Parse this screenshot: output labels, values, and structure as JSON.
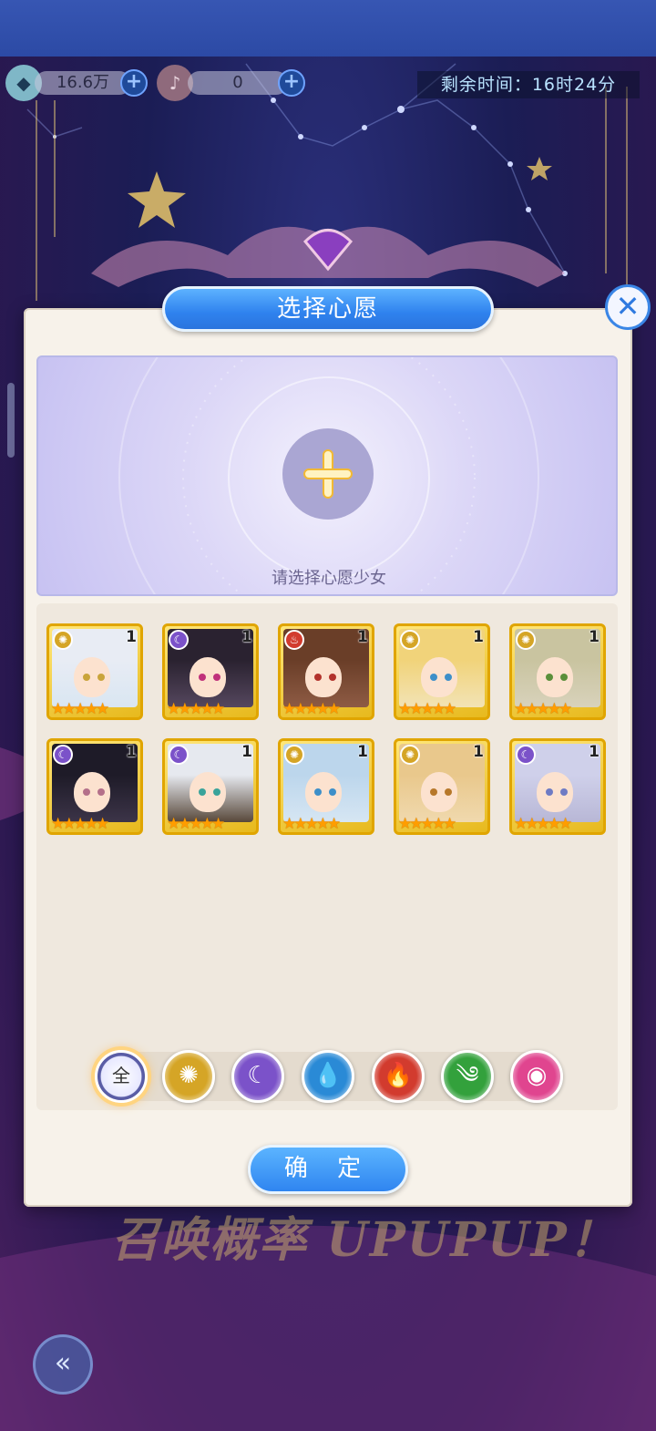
{
  "resources": {
    "gem_amount": "16.6万",
    "ticket_amount": "0"
  },
  "timer": {
    "text": "剩余时间：16时24分"
  },
  "dialog": {
    "title": "选择心愿",
    "close_glyph": "✕",
    "wish_hint": "请选择心愿少女",
    "confirm_label": "确 定"
  },
  "cards": [
    {
      "element": "light",
      "level": "1",
      "hair": "#e8ecf4",
      "eyes": "#c9a43a",
      "bg": "#d9e6f2"
    },
    {
      "element": "dark",
      "level": "1",
      "hair": "#2a2230",
      "eyes": "#c0307a",
      "bg": "#55475e"
    },
    {
      "element": "fire",
      "level": "1",
      "hair": "#6a3e28",
      "eyes": "#b3322b",
      "bg": "#8e5b44"
    },
    {
      "element": "light",
      "level": "1",
      "hair": "#f1d37a",
      "eyes": "#3d8fc9",
      "bg": "#f2e3b5"
    },
    {
      "element": "light",
      "level": "1",
      "hair": "#c9c4a0",
      "eyes": "#5a8f3a",
      "bg": "#d8d2bb"
    },
    {
      "element": "dark",
      "level": "1",
      "hair": "#1e1b28",
      "eyes": "#b4708a",
      "bg": "#3c3448"
    },
    {
      "element": "dark",
      "level": "1",
      "hair": "#e6e9ef",
      "eyes": "#3aa39a",
      "bg": "#58483a"
    },
    {
      "element": "light",
      "level": "1",
      "hair": "#bcd6ec",
      "eyes": "#3d8fc9",
      "bg": "#d6e6f3"
    },
    {
      "element": "light",
      "level": "1",
      "hair": "#e9c88c",
      "eyes": "#b7782a",
      "bg": "#f0d9ae"
    },
    {
      "element": "dark",
      "level": "1",
      "hair": "#cfd0ea",
      "eyes": "#6e7bc4",
      "bg": "#b8b7d6"
    }
  ],
  "card_stars": "★★★★★",
  "filters": [
    {
      "key": "all",
      "label": "全",
      "color": "#4a4c94",
      "icon": "all-icon"
    },
    {
      "key": "light",
      "label": "✺",
      "color": "#d5a526",
      "icon": "light-element-icon"
    },
    {
      "key": "dark",
      "label": "☾",
      "color": "#7b52c9",
      "icon": "dark-element-icon"
    },
    {
      "key": "water",
      "label": "💧",
      "color": "#2a8ad6",
      "icon": "water-element-icon"
    },
    {
      "key": "fire",
      "label": "🔥",
      "color": "#d23b2e",
      "icon": "fire-element-icon"
    },
    {
      "key": "wind",
      "label": "༄",
      "color": "#33a13c",
      "icon": "wind-element-icon"
    },
    {
      "key": "cosmic",
      "label": "◉",
      "color": "#e0458f",
      "icon": "cosmic-element-icon"
    }
  ],
  "element_colors": {
    "light": "#d5a526",
    "dark": "#7b52c9",
    "fire": "#d23b2e"
  },
  "element_glyphs": {
    "light": "✺",
    "dark": "☾",
    "fire": "♨"
  },
  "banner_text": "召唤概率 UPUPUP！",
  "back_glyph": "«"
}
